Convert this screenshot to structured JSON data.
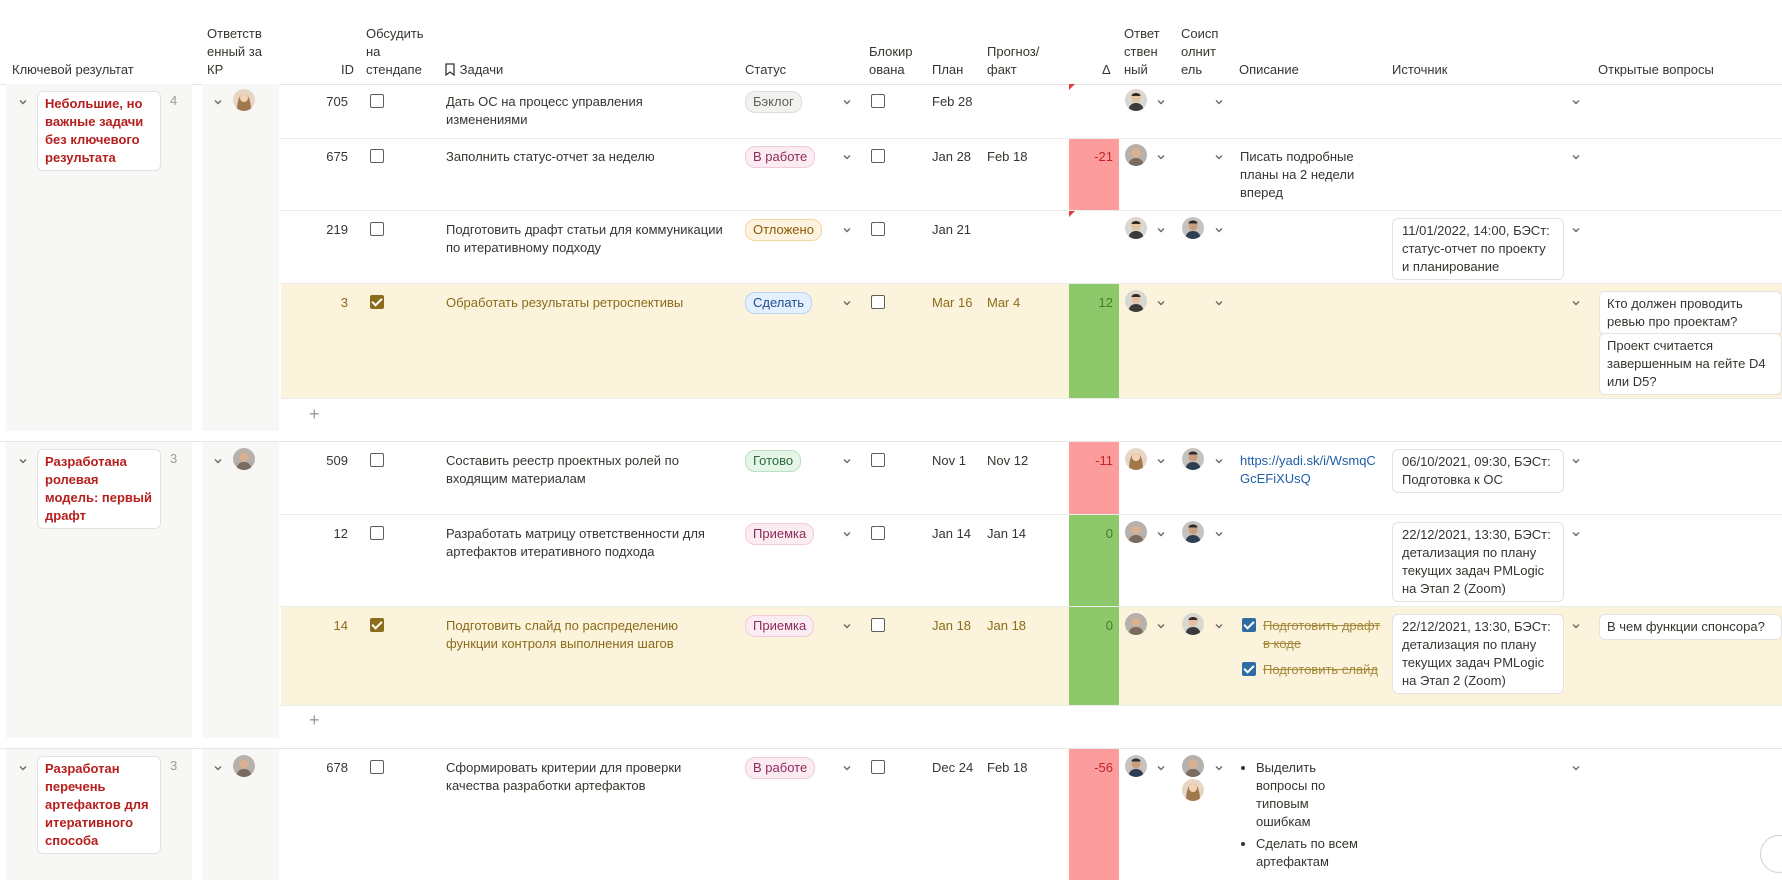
{
  "headers": {
    "key_result": "Ключевой результат",
    "owner_kr": "Ответств енный за КР",
    "id": "ID",
    "discuss": "Обсудить на стендапе",
    "tasks": "Задачи",
    "status": "Статус",
    "blocked": "Блокир ована",
    "plan": "План",
    "forecast": "Прогноз/ факт",
    "delta": "Δ",
    "responsible": "Ответ ствен ный",
    "coexec": "Соисп олнит ель",
    "description": "Описание",
    "source": "Источник",
    "questions": "Открытые вопросы"
  },
  "colors": {
    "delta_negative": "#fd9c9c",
    "delta_positive": "#8dc96b",
    "kr_title": "#b5201e",
    "highlight_row": "#fbf3db"
  },
  "groups": [
    {
      "kr": "Небольшие, но важные задачи без ключевого результата",
      "count": "4",
      "rows": [
        {
          "id": "705",
          "discuss": false,
          "task": "Дать ОС на процесс управления изменениями",
          "status": "Бэклог",
          "plan": "Feb 28",
          "fact": "",
          "delta": "",
          "desc": "",
          "source": "",
          "questions": []
        },
        {
          "id": "675",
          "discuss": false,
          "task": "Заполнить статус-отчет за неделю",
          "status": "В работе",
          "plan": "Jan 28",
          "fact": "Feb 18",
          "delta": "-21",
          "desc": "Писать подробные планы на 2 недели вперед",
          "source": "",
          "questions": []
        },
        {
          "id": "219",
          "discuss": false,
          "task": "Подготовить драфт статьи для коммуникации по итеративному подходу",
          "status": "Отложено",
          "plan": "Jan 21",
          "fact": "",
          "delta": "",
          "desc": "",
          "source": "11/01/2022, 14:00, БЭСт: статус-отчет по проекту и планирование",
          "questions": []
        },
        {
          "id": "3",
          "discuss": true,
          "task": "Обработать результаты ретроспективы",
          "status": "Сделать",
          "plan": "Mar 16",
          "fact": "Mar 4",
          "delta": "12",
          "desc": "",
          "source": "",
          "questions": [
            "Кто должен проводить ревью про проектам?",
            "Проект считается завершенным на гейте D4 или D5?"
          ]
        }
      ]
    },
    {
      "kr": "Разработана ролевая модель: первый драфт",
      "count": "3",
      "rows": [
        {
          "id": "509",
          "discuss": false,
          "task": "Составить реестр проектных ролей по входящим материалам",
          "status": "Готово",
          "plan": "Nov 1",
          "fact": "Nov 12",
          "delta": "-11",
          "desc": "https://yadi.sk/i/WsmqCGcEFiXUsQ",
          "source": "06/10/2021, 09:30, БЭСт: Подготовка к ОС",
          "questions": []
        },
        {
          "id": "12",
          "discuss": false,
          "task": "Разработать матрицу ответственности для артефактов итеративного подхода",
          "status": "Приемка",
          "plan": "Jan 14",
          "fact": "Jan 14",
          "delta": "0",
          "desc": "",
          "source": "22/12/2021, 13:30, БЭСт: детализация по плану текущих задач PMLogic на Этап 2 (Zoom)",
          "questions": []
        },
        {
          "id": "14",
          "discuss": true,
          "task": "Подготовить слайд по распределению функции контроля выполнения шагов",
          "status": "Приемка",
          "plan": "Jan 18",
          "fact": "Jan 18",
          "delta": "0",
          "desc_items": [
            "Подготовить драфт в коде",
            "Подготовить слайд"
          ],
          "source": "22/12/2021, 13:30, БЭСт: детализация по плану текущих задач PMLogic на Этап 2 (Zoom)",
          "questions": [
            "В чем функции спонсора?"
          ]
        }
      ]
    },
    {
      "kr": "Разработан перечень артефактов для итеративного способа",
      "count": "3",
      "rows": [
        {
          "id": "678",
          "discuss": false,
          "task": "Сформировать критерии для проверки качества разработки артефактов",
          "status": "В работе",
          "plan": "Dec 24",
          "fact": "Feb 18",
          "delta": "-56",
          "desc_bullets": [
            "Выделить вопросы по типовым ошибкам",
            "Сделать по всем артефактам"
          ],
          "source": "",
          "questions": []
        }
      ]
    }
  ]
}
